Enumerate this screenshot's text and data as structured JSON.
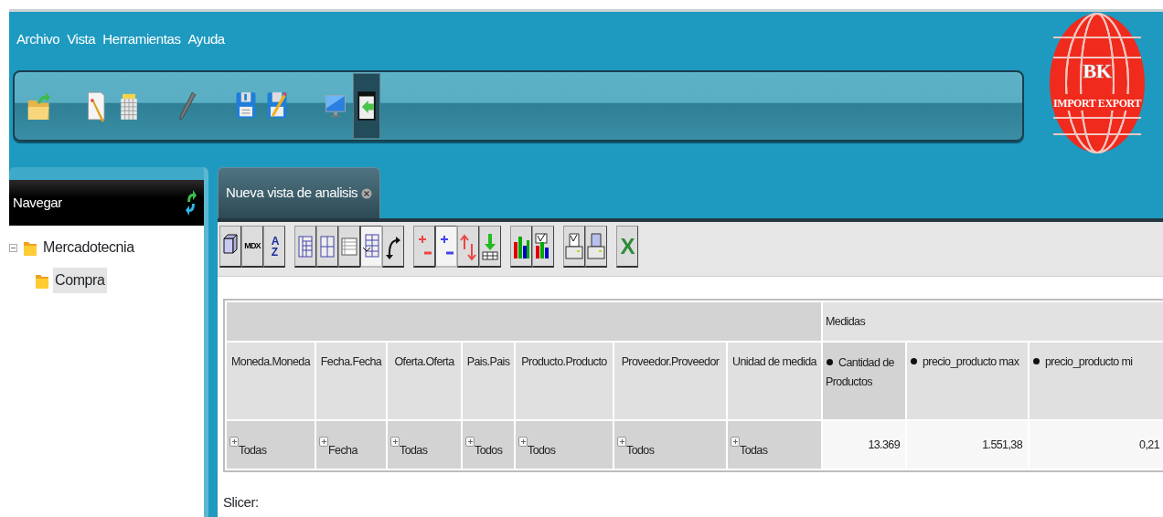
{
  "menu": [
    "Archivo",
    "Vista",
    "Herramientas",
    "Ayuda"
  ],
  "main_toolbar": [
    [
      {
        "kind": "folder-open",
        "pressed": false
      }
    ],
    [
      {
        "kind": "document-edit",
        "pressed": false
      },
      {
        "kind": "spreadsheet",
        "pressed": false
      }
    ],
    [
      {
        "kind": "pen",
        "pressed": false
      }
    ],
    [
      {
        "kind": "save",
        "pressed": false
      },
      {
        "kind": "save-as",
        "pressed": false
      }
    ],
    [
      {
        "kind": "monitor",
        "pressed": false
      },
      {
        "kind": "panel-arrow",
        "pressed": true
      }
    ]
  ],
  "logo": {
    "line1": "BK",
    "line2": "IMPORT EXPORT"
  },
  "sidebar": {
    "title": "Navegar",
    "tree": [
      {
        "label": "Mercadotecnia",
        "expanded": true,
        "selected": false,
        "children": [
          {
            "label": "Compra",
            "selected": true
          }
        ]
      }
    ]
  },
  "tabs": [
    {
      "label": "Nueva vista de analisis",
      "selected": true
    }
  ],
  "analysis_toolbar": [
    [
      {
        "kind": "cube",
        "pressed": false
      },
      {
        "kind": "mdx",
        "label": "MDX",
        "pressed": false
      },
      {
        "kind": "sort",
        "label": "AZ",
        "pressed": false
      }
    ],
    [
      {
        "kind": "tree-rows",
        "pressed": false
      },
      {
        "kind": "columns",
        "pressed": false
      },
      {
        "kind": "table",
        "pressed": false
      },
      {
        "kind": "grid",
        "pressed": true
      },
      {
        "kind": "swap",
        "pressed": false
      }
    ],
    [
      {
        "kind": "plus-minus-red",
        "pressed": false
      },
      {
        "kind": "plus-minus-blue",
        "pressed": true
      },
      {
        "kind": "up-down",
        "pressed": false
      },
      {
        "kind": "drill",
        "pressed": false
      }
    ],
    [
      {
        "kind": "bar-chart",
        "pressed": false
      },
      {
        "kind": "chart-config",
        "pressed": false
      }
    ],
    [
      {
        "kind": "print-setup",
        "pressed": false
      },
      {
        "kind": "print",
        "pressed": false
      }
    ],
    [
      {
        "kind": "excel",
        "label": "X",
        "pressed": false
      }
    ]
  ],
  "table": {
    "group_header": "Medidas",
    "columns": [
      {
        "label": "Moneda.Moneda",
        "kind": "dimension"
      },
      {
        "label": "Fecha.Fecha",
        "kind": "dimension"
      },
      {
        "label": "Oferta.Oferta",
        "kind": "dimension"
      },
      {
        "label": "Pais.Pais",
        "kind": "dimension"
      },
      {
        "label": "Producto.Producto",
        "kind": "dimension"
      },
      {
        "label": "Proveedor.Proveedor",
        "kind": "dimension"
      },
      {
        "label": "Unidad de medida",
        "kind": "dimension"
      },
      {
        "label": "Cantidad de Productos",
        "kind": "measure"
      },
      {
        "label": "precio_producto max",
        "kind": "measure"
      },
      {
        "label": "precio_producto mi",
        "kind": "measure"
      }
    ],
    "rows": [
      [
        "Todas",
        "Fecha",
        "Todas",
        "Todos",
        "Todos",
        "Todos",
        "Todas",
        "13.369",
        "1.551,38",
        "0,21"
      ]
    ]
  },
  "slicer": "Slicer:"
}
